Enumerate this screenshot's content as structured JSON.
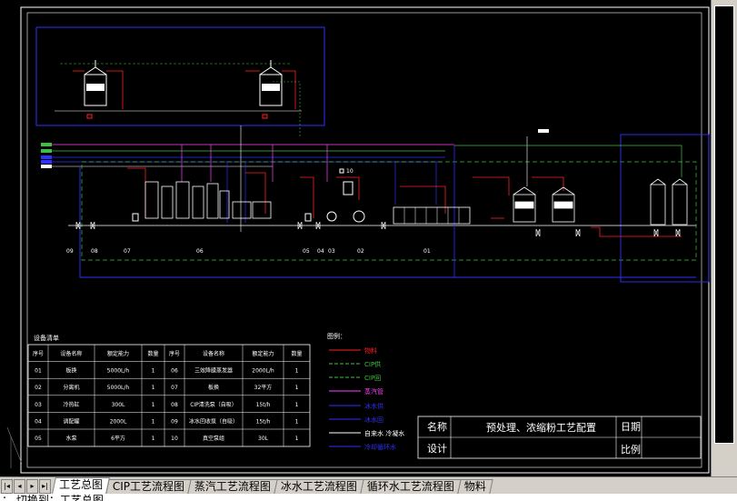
{
  "drawing": {
    "zone_labels": [
      "09",
      "08",
      "07",
      "06",
      "05",
      "04",
      "03",
      "02",
      "01"
    ],
    "equipment_table": {
      "title": "设备清单",
      "headers": [
        "序号",
        "设备名称",
        "额定能力",
        "数量",
        "序号",
        "设备名称",
        "额定能力",
        "数量"
      ],
      "rows": [
        [
          "01",
          "板换",
          "5000L/h",
          "1",
          "06",
          "三效降膜蒸发器",
          "2000L/h",
          "1"
        ],
        [
          "02",
          "分离机",
          "5000L/h",
          "1",
          "07",
          "板换",
          "32平方",
          "1"
        ],
        [
          "03",
          "冷热缸",
          "300L",
          "1",
          "08",
          "CIP清洗泵（自吸）",
          "15t/h",
          "1"
        ],
        [
          "04",
          "调配罐",
          "2000L",
          "1",
          "09",
          "冰水回收泵（自吸）",
          "15t/h",
          "1"
        ],
        [
          "05",
          "水泵",
          "6平方",
          "1",
          "10",
          "真空泵组",
          "30L",
          "1"
        ]
      ]
    },
    "legend": {
      "title": "图例：",
      "items": [
        {
          "label": "物料",
          "color": "#ff2020"
        },
        {
          "label": "CIP供",
          "color": "#40c040"
        },
        {
          "label": "CIP回",
          "color": "#40c040"
        },
        {
          "label": "蒸汽管",
          "color": "#ff40ff"
        },
        {
          "label": "冰水供",
          "color": "#3030ff"
        },
        {
          "label": "冰水回",
          "color": "#3030ff"
        },
        {
          "label": "自来水  冷凝水",
          "color": "#ffffff"
        },
        {
          "label": "冷却循环水",
          "color": "#3030ff"
        }
      ]
    },
    "title_block": {
      "name_label": "名称",
      "name_value": "预处理、浓缩粉工艺配置",
      "date_label": "日期",
      "design_label": "设计",
      "scale_label": "比例"
    },
    "valve_label": "10"
  },
  "tabs": [
    {
      "label": "工艺总图",
      "active": true
    },
    {
      "label": "CIP工艺流程图",
      "active": false
    },
    {
      "label": "蒸汽工艺流程图",
      "active": false
    },
    {
      "label": "冰水工艺流程图",
      "active": false
    },
    {
      "label": "循环水工艺流程图",
      "active": false
    },
    {
      "label": "物料",
      "active": false
    }
  ],
  "command_line": "：  切换到：工艺总图",
  "colors": {
    "background": "#000000",
    "frame": "#ffffff",
    "material": "#ff2020",
    "cip": "#40c040",
    "steam": "#ff40ff",
    "chilled_water": "#3030ff",
    "cooling_water": "#4040ff"
  }
}
